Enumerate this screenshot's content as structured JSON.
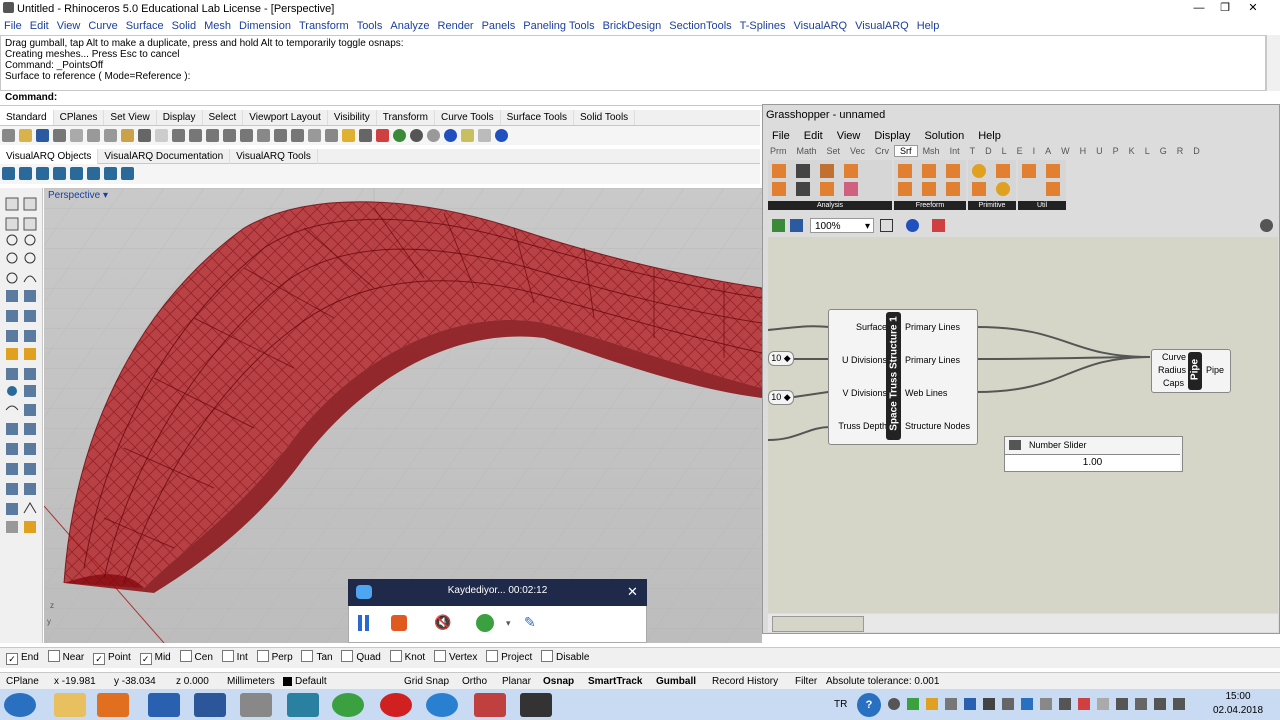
{
  "window": {
    "title": "Untitled - Rhinoceros 5.0 Educational Lab License - [Perspective]"
  },
  "menu": [
    "File",
    "Edit",
    "View",
    "Curve",
    "Surface",
    "Solid",
    "Mesh",
    "Dimension",
    "Transform",
    "Tools",
    "Analyze",
    "Render",
    "Panels",
    "Paneling Tools",
    "BrickDesign",
    "SectionTools",
    "T-Splines",
    "VisualARQ",
    "VisualARQ",
    "Help"
  ],
  "command_history": [
    "Drag gumball, tap Alt to make a duplicate, press and hold Alt to temporarily toggle osnaps:",
    "Creating meshes... Press Esc to cancel",
    "Command: _PointsOff",
    "Surface to reference ( Mode=Reference ):"
  ],
  "command_prompt": "Command:",
  "toolbar_tabs": [
    "Standard",
    "CPlanes",
    "Set View",
    "Display",
    "Select",
    "Viewport Layout",
    "Visibility",
    "Transform",
    "Curve Tools",
    "Surface Tools",
    "Solid Tools"
  ],
  "toolbar2_tabs": [
    "VisualARQ Objects",
    "VisualARQ Documentation",
    "VisualARQ Tools"
  ],
  "viewport_label": "Perspective",
  "grasshopper": {
    "title": "Grasshopper - unnamed",
    "menu": [
      "File",
      "Edit",
      "View",
      "Display",
      "Solution",
      "Help"
    ],
    "categories": [
      "Prm",
      "Math",
      "Set",
      "Vec",
      "Crv",
      "Srf",
      "Msh",
      "Int",
      "T",
      "D",
      "L",
      "E",
      "I",
      "A",
      "W",
      "H",
      "U",
      "P",
      "K",
      "L",
      "G",
      "R",
      "D"
    ],
    "active_category": "Srf",
    "groups": [
      "Analysis",
      "Freeform",
      "Primitive",
      "Util"
    ],
    "zoom": "100%",
    "component": {
      "name": "Space Truss Structure 1",
      "inputs": [
        "Surface",
        "U Divisions",
        "V Divisions",
        "Truss Depth"
      ],
      "outputs": [
        "Primary Lines",
        "Primary Lines",
        "Web Lines",
        "Structure Nodes"
      ]
    },
    "sliders": [
      "10",
      "10"
    ],
    "pipe": {
      "name": "Pipe",
      "inputs": [
        "Curve",
        "Radius",
        "Caps"
      ],
      "output": "Pipe"
    },
    "number_slider": {
      "label": "Number Slider",
      "value": "1.00"
    }
  },
  "recorder": {
    "text": "Kaydediyor... 00:02:12"
  },
  "osnaps": [
    {
      "label": "End",
      "checked": true
    },
    {
      "label": "Near",
      "checked": false
    },
    {
      "label": "Point",
      "checked": true
    },
    {
      "label": "Mid",
      "checked": true
    },
    {
      "label": "Cen",
      "checked": false
    },
    {
      "label": "Int",
      "checked": false
    },
    {
      "label": "Perp",
      "checked": false
    },
    {
      "label": "Tan",
      "checked": false
    },
    {
      "label": "Quad",
      "checked": false
    },
    {
      "label": "Knot",
      "checked": false
    },
    {
      "label": "Vertex",
      "checked": false
    },
    {
      "label": "Project",
      "checked": false
    },
    {
      "label": "Disable",
      "checked": false
    }
  ],
  "status": {
    "cplane": "CPlane",
    "x": "x -19.981",
    "y": "y -38.034",
    "z": "z 0.000",
    "units": "Millimeters",
    "layer": "Default",
    "grid_snap": "Grid Snap",
    "ortho": "Ortho",
    "planar": "Planar",
    "osnap": "Osnap",
    "smarttrack": "SmartTrack",
    "gumball": "Gumball",
    "record_history": "Record History",
    "filter": "Filter",
    "tolerance": "Absolute tolerance: 0.001"
  },
  "taskbar": {
    "lang": "TR",
    "time": "15:00",
    "date": "02.04.2018"
  },
  "colors": {
    "accent": "#1b3fa0",
    "model_red": "#b3151b",
    "gh_canvas": "#d6d6c8"
  }
}
